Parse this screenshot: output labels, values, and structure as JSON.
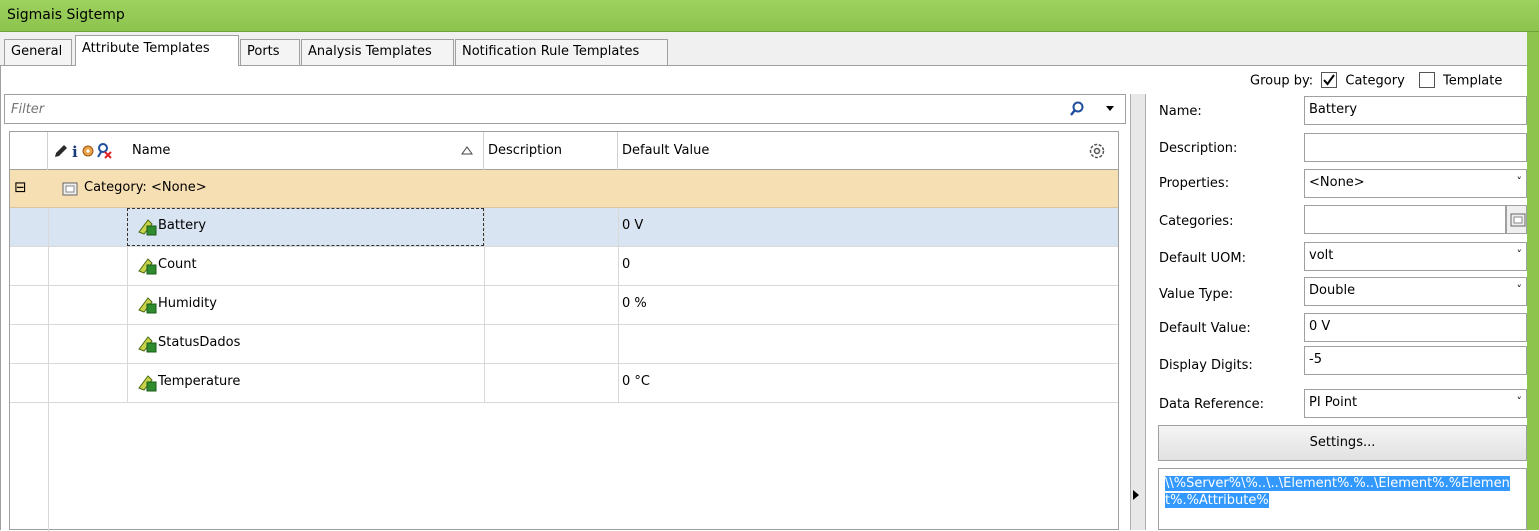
{
  "window": {
    "title": "Sigmais Sigtemp"
  },
  "tabs": [
    "General",
    "Attribute Templates",
    "Ports",
    "Analysis Templates",
    "Notification Rule Templates"
  ],
  "active_tab": "Attribute Templates",
  "group_by": {
    "label": "Group by:",
    "category_label": "Category",
    "category_checked": true,
    "template_label": "Template",
    "template_checked": false
  },
  "filter": {
    "placeholder": "Filter",
    "value": ""
  },
  "grid": {
    "columns": {
      "name": "Name",
      "description": "Description",
      "default_value": "Default Value"
    },
    "category_row": {
      "label": "Category: <None>",
      "expander": "⊟"
    },
    "rows": [
      {
        "name": "Battery",
        "description": "",
        "default_value": "0 V",
        "selected": true
      },
      {
        "name": "Count",
        "description": "",
        "default_value": "0",
        "selected": false
      },
      {
        "name": "Humidity",
        "description": "",
        "default_value": "0 %",
        "selected": false
      },
      {
        "name": "StatusDados",
        "description": "",
        "default_value": "",
        "selected": false
      },
      {
        "name": "Temperature",
        "description": "",
        "default_value": "0 °C",
        "selected": false
      }
    ]
  },
  "properties": {
    "name": {
      "label": "Name:",
      "value": "Battery"
    },
    "description": {
      "label": "Description:",
      "value": ""
    },
    "properties": {
      "label": "Properties:",
      "value": "<None>"
    },
    "categories": {
      "label": "Categories:",
      "value": ""
    },
    "default_uom": {
      "label": "Default UOM:",
      "value": "volt"
    },
    "value_type": {
      "label": "Value Type:",
      "value": "Double"
    },
    "default_value": {
      "label": "Default Value:",
      "value": "0 V"
    },
    "display_digits": {
      "label": "Display Digits:",
      "value": "-5"
    },
    "data_reference": {
      "label": "Data Reference:",
      "value": "PI Point"
    },
    "settings_button": "Settings...",
    "reference_string": "\\\\%Server%\\%..\\..\\Element%.%..\\Element%.%Element%.%Attribute%"
  },
  "colors": {
    "titlebar": "#8cc44d",
    "category_row": "#f7dfb4",
    "selected_row": "#d9e4f2",
    "highlight": "#3399ff"
  },
  "icons": [
    "edit-pencil-icon",
    "info-icon",
    "config-icon",
    "exclude-icon",
    "sort-asc-icon",
    "column-settings-icon",
    "category-folder-icon",
    "attribute-template-icon",
    "search-icon",
    "dropdown-arrow-icon",
    "current-row-arrow-icon"
  ]
}
